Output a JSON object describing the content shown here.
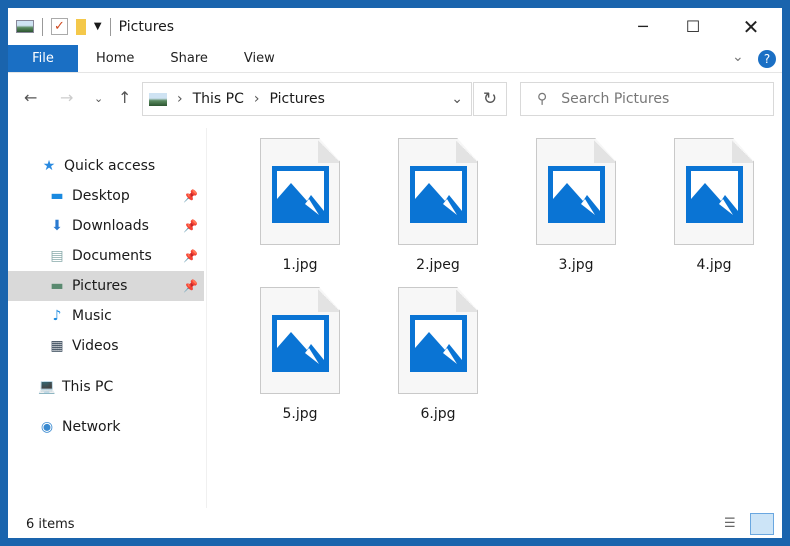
{
  "window": {
    "title": "Pictures"
  },
  "ribbon": {
    "tabs": [
      "File",
      "Home",
      "Share",
      "View"
    ]
  },
  "address": {
    "path": [
      "This PC",
      "Pictures"
    ]
  },
  "search": {
    "placeholder": "Search Pictures"
  },
  "sidebar": {
    "items": [
      {
        "label": "Quick access",
        "icon": "star-icon"
      },
      {
        "label": "Desktop",
        "icon": "desktop-icon",
        "pinned": true
      },
      {
        "label": "Downloads",
        "icon": "download-icon",
        "pinned": true
      },
      {
        "label": "Documents",
        "icon": "documents-icon",
        "pinned": true
      },
      {
        "label": "Pictures",
        "icon": "pictures-icon",
        "pinned": true,
        "selected": true
      },
      {
        "label": "Music",
        "icon": "music-icon"
      },
      {
        "label": "Videos",
        "icon": "videos-icon"
      },
      {
        "label": "This PC",
        "icon": "computer-icon"
      },
      {
        "label": "Network",
        "icon": "network-icon"
      }
    ]
  },
  "files": [
    "1.jpg",
    "2.jpeg",
    "3.jpg",
    "4.jpg",
    "5.jpg",
    "6.jpg"
  ],
  "status": {
    "count": "6 items"
  },
  "colors": {
    "accent": "#1a6fc4",
    "border": "#1a64ad",
    "image_icon": "#0a74d4"
  }
}
